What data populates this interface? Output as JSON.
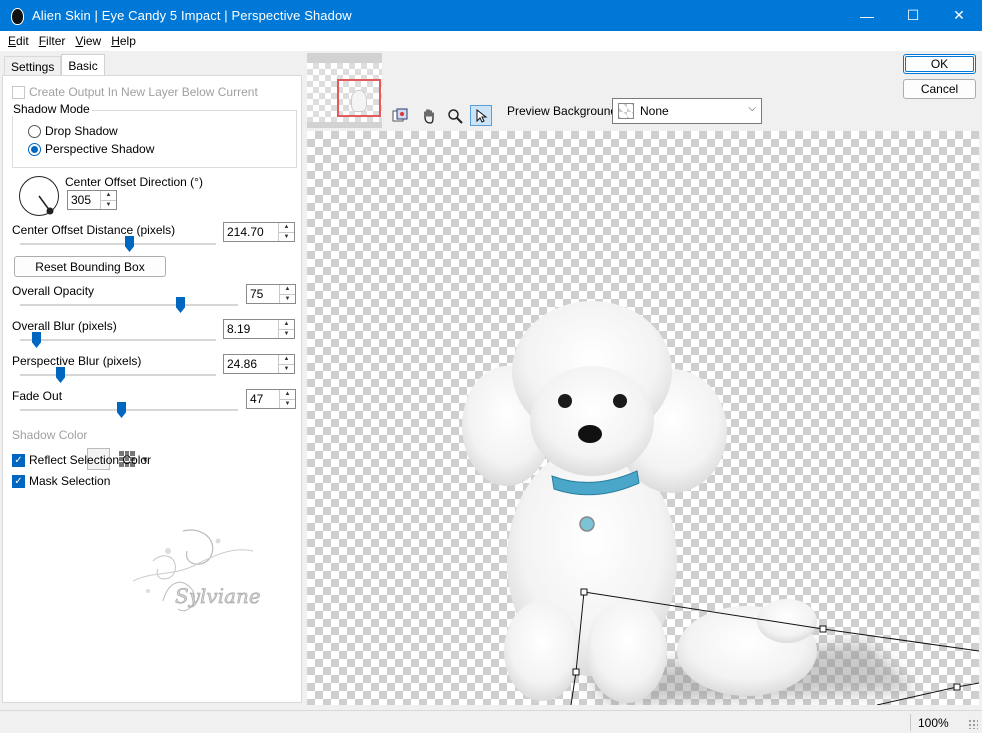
{
  "window": {
    "title": "Alien Skin | Eye Candy 5 Impact | Perspective Shadow",
    "minimize": "—",
    "maximize": "☐",
    "close": "✕"
  },
  "menu": [
    "Edit",
    "Filter",
    "View",
    "Help"
  ],
  "menu_underline": [
    "E",
    "F",
    "V",
    "H"
  ],
  "menu_rest": [
    "dit",
    "ilter",
    "iew",
    "elp"
  ],
  "tabs": {
    "settings": "Settings",
    "basic": "Basic"
  },
  "basic": {
    "create_output": {
      "label": "Create Output In New Layer Below Current",
      "checked": false,
      "enabled": false
    },
    "shadow_mode": {
      "title": "Shadow Mode",
      "options": [
        "Drop Shadow",
        "Perspective Shadow"
      ],
      "selected": "Perspective Shadow"
    },
    "center_offset_direction": {
      "label": "Center Offset Direction (°)",
      "value": "305"
    },
    "center_offset_distance": {
      "label": "Center Offset Distance (pixels)",
      "value": "214.70",
      "fraction": 0.56
    },
    "reset_button": "Reset Bounding Box",
    "overall_opacity": {
      "label": "Overall Opacity",
      "value": "75",
      "fraction": 0.75
    },
    "overall_blur": {
      "label": "Overall Blur (pixels)",
      "value": "8.19",
      "fraction": 0.08
    },
    "perspective_blur": {
      "label": "Perspective Blur (pixels)",
      "value": "24.86",
      "fraction": 0.2
    },
    "fade_out": {
      "label": "Fade Out",
      "value": "47",
      "fraction": 0.47
    },
    "shadow_color": {
      "label": "Shadow Color",
      "enabled": false,
      "swatch": "#f3f3f3"
    },
    "reflect_selection_color": {
      "label": "Reflect Selection Color",
      "checked": true
    },
    "mask_selection": {
      "label": "Mask Selection",
      "checked": true
    }
  },
  "watermark": {
    "text": "Sylviane"
  },
  "preview": {
    "background_label": "Preview Background:",
    "background_value": "None",
    "tools": [
      "preview-tool-icon",
      "hand-icon",
      "zoom-icon",
      "arrow-select-icon"
    ]
  },
  "buttons": {
    "ok": "OK",
    "cancel": "Cancel"
  },
  "status": {
    "zoom": "100%"
  },
  "colors": {
    "titlebar": "#0078d7",
    "accent": "#0067c0"
  }
}
